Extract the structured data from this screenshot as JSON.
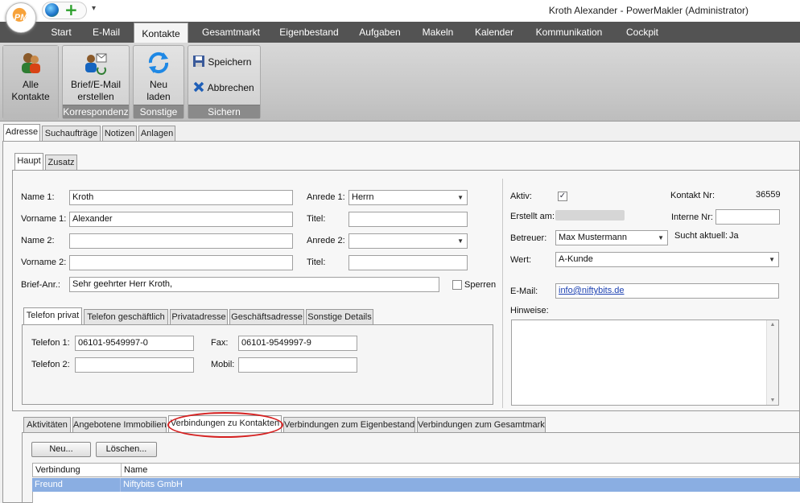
{
  "app": {
    "title": "Kroth Alexander - PowerMakler (Administrator)",
    "logo": "PM"
  },
  "ribbon_tabs": [
    "Start",
    "E-Mail",
    "Kontakte",
    "Gesamtmarkt",
    "Eigenbestand",
    "Aufgaben",
    "Makeln",
    "Kalender",
    "Kommunikation",
    "Cockpit"
  ],
  "ribbon": {
    "alle_kontakte": "Alle Kontakte",
    "brief_email": "Brief/E-Mail erstellen",
    "group_korrespondenz": "Korrespondenz",
    "neu_laden": "Neu laden",
    "group_sonstige": "Sonstige",
    "speichern": "Speichern",
    "abbrechen": "Abbrechen",
    "group_sichern": "Sichern"
  },
  "main_tabs": [
    "Adresse",
    "Suchaufträge",
    "Notizen",
    "Anlagen"
  ],
  "sub_tabs": [
    "Haupt",
    "Zusatz"
  ],
  "form": {
    "name1_label": "Name 1:",
    "name1": "Kroth",
    "vorname1_label": "Vorname 1:",
    "vorname1": "Alexander",
    "name2_label": "Name 2:",
    "name2": "",
    "vorname2_label": "Vorname 2:",
    "vorname2": "",
    "anrede1_label": "Anrede 1:",
    "anrede1": "Herrn",
    "titel1_label": "Titel:",
    "titel1": "",
    "anrede2_label": "Anrede 2:",
    "anrede2": "",
    "titel2_label": "Titel:",
    "titel2": "",
    "briefanr_label": "Brief-Anr.:",
    "briefanr": "Sehr geehrter Herr Kroth,",
    "sperren_label": "Sperren"
  },
  "phone_tabs": [
    "Telefon privat",
    "Telefon geschäftlich",
    "Privatadresse",
    "Geschäftsadresse",
    "Sonstige Details"
  ],
  "phone": {
    "tel1_label": "Telefon 1:",
    "tel1": "06101-9549997-0",
    "tel2_label": "Telefon 2:",
    "tel2": "",
    "fax_label": "Fax:",
    "fax": "06101-9549997-9",
    "mobil_label": "Mobil:",
    "mobil": ""
  },
  "right": {
    "aktiv_label": "Aktiv:",
    "aktiv_checked": true,
    "kontakt_nr_label": "Kontakt Nr:",
    "kontakt_nr": "36559",
    "erstellt_label": "Erstellt am:",
    "interne_nr_label": "Interne Nr:",
    "interne_nr": "",
    "betreuer_label": "Betreuer:",
    "betreuer": "Max Mustermann",
    "sucht_label": "Sucht aktuell:",
    "sucht": "Ja",
    "wert_label": "Wert:",
    "wert": "A-Kunde",
    "email_label": "E-Mail:",
    "email": "info@niftybits.de",
    "hinweise_label": "Hinweise:"
  },
  "bottom_tabs": [
    "Aktivitäten",
    "Angebotene Immobilien",
    "Verbindungen zu Kontakten",
    "Verbindungen zum Eigenbestand",
    "Verbindungen zum Gesamtmarkt"
  ],
  "bottom": {
    "neu": "Neu...",
    "loeschen": "Löschen..."
  },
  "grid": {
    "columns": [
      "Verbindung",
      "Name"
    ],
    "rows": [
      [
        "Freund",
        "Niftybits GmbH"
      ]
    ]
  },
  "colors": {
    "accent_tab_bar": "#535353",
    "highlight_oval": "#d52020",
    "selected_row": "#8aaee2"
  }
}
